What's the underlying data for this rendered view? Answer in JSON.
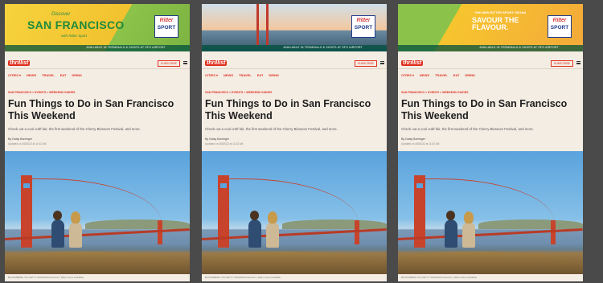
{
  "ads": [
    {
      "variant": "yellow",
      "discover": "Discover",
      "city": "SAN FRANCISCO",
      "tagline": "with Ritter Sport",
      "footer": "AVAILABLE IN TERMINALS & SHOPS AT SFO AIRPORT",
      "logo_top": "Ritter",
      "logo_bottom": "SPORT"
    },
    {
      "variant": "bridge",
      "footer": "AVAILABLE IN TERMINALS & SHOPS AT SFO AIRPORT",
      "logo_top": "Ritter",
      "logo_bottom": "SPORT"
    },
    {
      "variant": "choco",
      "kicker": "THE NEW RITTER SPORT VEGAN",
      "headline_1": "SAVOUR THE",
      "headline_2": "FLAVOUR.",
      "footer": "AVAILABLE IN TERMINALS & SHOPS AT SFO AIRPORT",
      "logo_top": "Ritter",
      "logo_bottom": "SPORT"
    }
  ],
  "site": {
    "brand": "thrillist",
    "subscribe": "SUBSCRIBE",
    "nav": [
      "CITIES ▾",
      "NEWS",
      "TRAVEL",
      "EAT",
      "DRINK"
    ]
  },
  "article": {
    "breadcrumb": "SAN FRANCISCO > EVENTS > WEEKEND GUIDES",
    "headline": "Fun Things to Do in San Francisco This Weekend",
    "dek": "Check out a cool craft fair, the first weekend of the Cherry Blossom Festival, and more.",
    "byline": "By Daisy Barringer",
    "updated": "Updated on 4/8/2022 at 11:42 AM",
    "credit": "BLOOMBERG VIA GETTY IMAGES/Production | Ritter Fotos Available"
  },
  "colors": {
    "brand_red": "#e0301e",
    "page_bg": "#f4ede4",
    "ritter_blue": "#1e3b8c"
  }
}
